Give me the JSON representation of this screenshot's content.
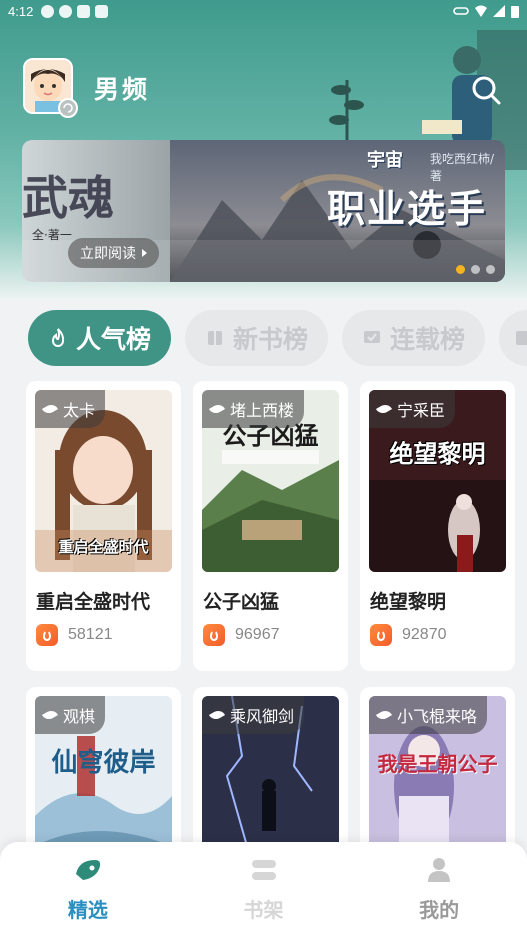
{
  "status_bar": {
    "time": "4:12"
  },
  "header": {
    "channel_title": "男频"
  },
  "banner": {
    "left_title": "武魂",
    "left_author": "全·著一",
    "read_button": "立即阅读",
    "main_title": "职业选手",
    "main_subtitle": "宇宙",
    "main_author": "我吃西红柿/著",
    "slide_count": 3,
    "active_slide": 1
  },
  "tabs": [
    {
      "label": "人气榜",
      "active": true
    },
    {
      "label": "新书榜",
      "active": false
    },
    {
      "label": "连载榜",
      "active": false
    },
    {
      "label": "",
      "active": false
    }
  ],
  "books": [
    {
      "author": "太卡",
      "title": "重启全盛时代",
      "cover_text": "重启全盛时代",
      "count": "58121",
      "accent": "#c98a5a"
    },
    {
      "author": "堵上西楼",
      "title": "公子凶猛",
      "cover_text": "公子凶猛",
      "count": "96967",
      "accent": "#5a7f4a"
    },
    {
      "author": "宁采臣",
      "title": "绝望黎明",
      "cover_text": "绝望黎明",
      "count": "92870",
      "accent": "#5a1c1c"
    },
    {
      "author": "观棋",
      "title": "",
      "cover_text": "仙穹彼岸",
      "count": "",
      "accent": "#9cc0d8"
    },
    {
      "author": "乘风御剑",
      "title": "",
      "cover_text": "",
      "count": "",
      "accent": "#2b3048"
    },
    {
      "author": "小飞棍来咯",
      "title": "",
      "cover_text": "我是王朝公子",
      "count": "",
      "accent": "#8a7bb5"
    }
  ],
  "bottom_nav": [
    {
      "label": "精选",
      "icon": "featured-icon",
      "active": true
    },
    {
      "label": "书架",
      "icon": "bookshelf-icon",
      "active": false
    },
    {
      "label": "我的",
      "icon": "profile-icon",
      "active": false
    }
  ]
}
